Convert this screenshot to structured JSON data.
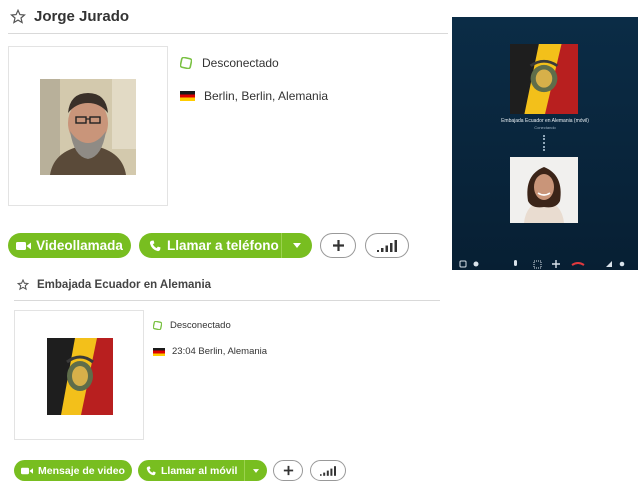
{
  "contact1": {
    "name": "Jorge Jurado",
    "status": "Desconectado",
    "location": "Berlin, Berlin, Alemania",
    "buttons": {
      "video": "Videollamada",
      "call": "Llamar a teléfono"
    }
  },
  "contact2": {
    "name": "Embajada Ecuador en Alemania",
    "status": "Desconectado",
    "location": "23:04 Berlin, Alemania",
    "buttons": {
      "video": "Mensaje de video",
      "call": "Llamar al móvil"
    }
  },
  "call_panel": {
    "callee": "Embajada Ecuador en Alemania (móvil)",
    "state": "Conectando"
  },
  "icons": {
    "star": "star-outline-icon",
    "status": "offline-status-icon",
    "flag": "germany-flag-icon",
    "video": "video-camera-icon",
    "phone": "phone-icon",
    "dropdown": "chevron-down-icon",
    "add": "plus-icon",
    "signal": "signal-bars-icon"
  },
  "colors": {
    "accent_green": "#78be20",
    "status_green": "#7ac143",
    "panel_bg": "#0b2c46",
    "hangup_red": "#e0393e"
  }
}
